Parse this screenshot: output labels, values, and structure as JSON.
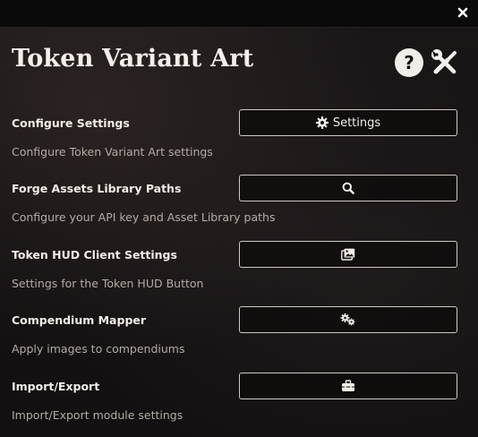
{
  "window": {
    "title": "Token Variant Art",
    "close_icon": "close-icon",
    "help_icon": "help-icon",
    "help_glyph": "?",
    "tools_icon": "tools-icon"
  },
  "rows": [
    {
      "label": "Configure Settings",
      "hint": "Configure Token Variant Art settings",
      "button_icon": "gear-icon",
      "button_text": "Settings"
    },
    {
      "label": "Forge Assets Library Paths",
      "hint": "Configure your API key and Asset Library paths",
      "button_icon": "search-icon",
      "button_text": ""
    },
    {
      "label": "Token HUD Client Settings",
      "hint": "Settings for the Token HUD Button",
      "button_icon": "images-icon",
      "button_text": ""
    },
    {
      "label": "Compendium Mapper",
      "hint": "Apply images to compendiums",
      "button_icon": "cogs-icon",
      "button_text": ""
    },
    {
      "label": "Import/Export",
      "hint": "Import/Export module settings",
      "button_icon": "toolbox-icon",
      "button_text": ""
    }
  ]
}
